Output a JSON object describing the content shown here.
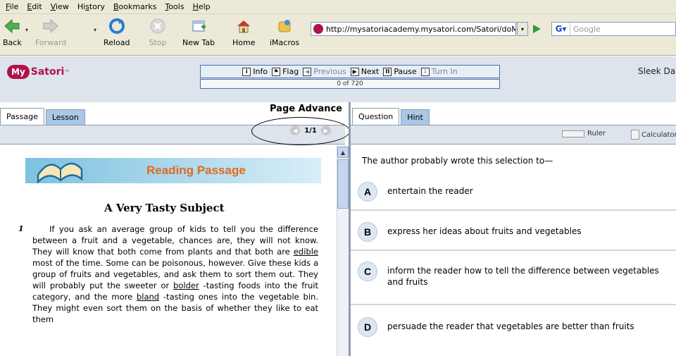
{
  "menu": [
    {
      "key": "F",
      "rest": "ile"
    },
    {
      "key": "E",
      "rest": "dit"
    },
    {
      "key": "V",
      "rest": "iew"
    },
    {
      "pre": "Hi",
      "key": "s",
      "rest": "tory"
    },
    {
      "key": "B",
      "rest": "ookmarks"
    },
    {
      "key": "T",
      "rest": "ools"
    },
    {
      "key": "H",
      "rest": "elp"
    }
  ],
  "nav": {
    "back": "Back",
    "forward": "Forward",
    "reload": "Reload",
    "stop": "Stop",
    "new_tab": "New Tab",
    "home": "Home",
    "imacros": "iMacros",
    "url": "http://mysatoriacademy.mysatori.com/Satori/doMy",
    "search_placeholder": "Google"
  },
  "app": {
    "logo_my": "My",
    "logo_name": "Satori",
    "logo_tm": "™",
    "tools": {
      "info": "Info",
      "flag": "Flag",
      "previous": "Previous",
      "next": "Next",
      "pause": "Pause",
      "turn_in": "Turn In"
    },
    "progress": "0 of 720",
    "user": "Sleek Da"
  },
  "left": {
    "tab_passage": "Passage",
    "tab_lesson": "Lesson",
    "page_advance": "Page Advance",
    "pager": "1/1",
    "banner": "Reading Passage",
    "title": "A Very Tasty Subject",
    "para_num": "1",
    "para_1": "If you ask an average group of kids to tell you the difference between a fruit and a vegetable, chances are, they will not know. They will know that both come from plants and that both are ",
    "word_edible": "edible",
    "para_2": " most of the time. Some can be poisonous, however. Give these kids a group of fruits and vegetables, and ask them to sort them out. They will probably put the sweeter or ",
    "word_bolder": "bolder",
    "para_3": " -tasting foods into the fruit category, and the more ",
    "word_bland": "bland",
    "para_4": " -tasting ones into the vegetable bin. They might even sort them on the basis of whether they like to eat them"
  },
  "right": {
    "tab_question": "Question",
    "tab_hint": "Hint",
    "ruler": "Ruler",
    "calculator": "Calculator",
    "question": "The author probably wrote this selection to—",
    "options": [
      {
        "letter": "A",
        "text": "entertain the reader"
      },
      {
        "letter": "B",
        "text": "express her ideas about fruits and vegetables"
      },
      {
        "letter": "C",
        "text": "inform the reader how to tell the difference between vegetables and fruits"
      },
      {
        "letter": "D",
        "text": "persuade the reader that vegetables are better than fruits"
      }
    ]
  }
}
